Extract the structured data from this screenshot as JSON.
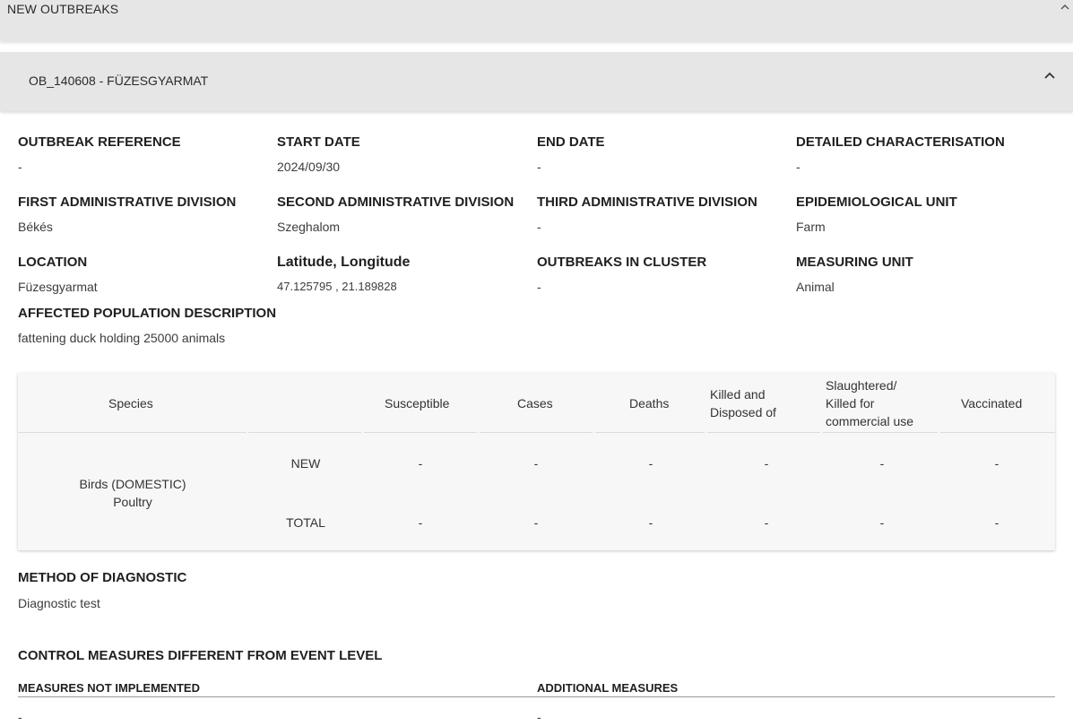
{
  "header": {
    "title": "NEW OUTBREAKS",
    "chevron_icon": "chevron-up-icon"
  },
  "outbreak": {
    "title": "OB_140608 - FÜZESGYARMAT",
    "chevron_icon": "chevron-up-icon"
  },
  "fields": {
    "outbreak_reference": {
      "label": "OUTBREAK REFERENCE",
      "value": "-"
    },
    "start_date": {
      "label": "START DATE",
      "value": "2024/09/30"
    },
    "end_date": {
      "label": "END DATE",
      "value": "-"
    },
    "detailed_characterisation": {
      "label": "DETAILED CHARACTERISATION",
      "value": "-"
    },
    "first_admin": {
      "label": "FIRST ADMINISTRATIVE DIVISION",
      "value": "Békés"
    },
    "second_admin": {
      "label": "SECOND ADMINISTRATIVE DIVISION",
      "value": "Szeghalom"
    },
    "third_admin": {
      "label": "THIRD ADMINISTRATIVE DIVISION",
      "value": "-"
    },
    "epi_unit": {
      "label": "EPIDEMIOLOGICAL UNIT",
      "value": "Farm"
    },
    "location": {
      "label": "LOCATION",
      "value": "Füzesgyarmat"
    },
    "lat_long": {
      "label": "Latitude, Longitude",
      "value": "47.125795 , 21.189828"
    },
    "outbreaks_in_cluster": {
      "label": "OUTBREAKS IN CLUSTER",
      "value": "-"
    },
    "measuring_unit": {
      "label": "MEASURING UNIT",
      "value": "Animal"
    },
    "affected_population": {
      "label": "AFFECTED POPULATION DESCRIPTION",
      "value": "fattening duck holding 25000 animals"
    }
  },
  "table": {
    "headers": {
      "species": "Species",
      "susceptible": "Susceptible",
      "cases": "Cases",
      "deaths": "Deaths",
      "killed_line1": "Killed and",
      "killed_line2": "Disposed of",
      "slaughtered_line1": "Slaughtered/",
      "slaughtered_line2": "Killed for",
      "slaughtered_line3": "commercial use",
      "vaccinated": "Vaccinated"
    },
    "species_line1": "Birds (DOMESTIC)",
    "species_line2": "Poultry",
    "rows": [
      {
        "label": "NEW",
        "values": [
          "-",
          "-",
          "-",
          "-",
          "-",
          "-"
        ]
      },
      {
        "label": "TOTAL",
        "values": [
          "-",
          "-",
          "-",
          "-",
          "-",
          "-"
        ]
      }
    ]
  },
  "method": {
    "label": "METHOD OF DIAGNOSTIC",
    "value": "Diagnostic test"
  },
  "control": {
    "title": "CONTROL MEASURES DIFFERENT FROM EVENT LEVEL",
    "not_implemented_label": "MEASURES NOT IMPLEMENTED",
    "not_implemented_value": "-",
    "additional_label": "ADDITIONAL MEASURES",
    "additional_value": "-"
  }
}
